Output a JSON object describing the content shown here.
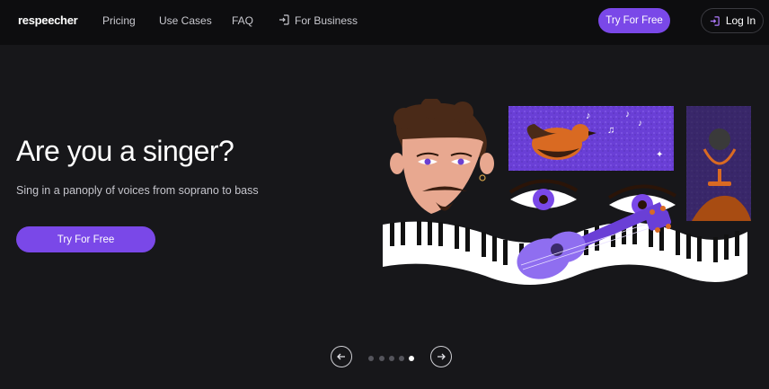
{
  "nav": {
    "logo": "respeecher",
    "links": [
      "Pricing",
      "Use Cases",
      "FAQ",
      "For Business"
    ],
    "cta_label": "Try For Free",
    "login_label": "Log In"
  },
  "hero": {
    "title": "Are you a singer?",
    "subtitle": "Sing in a panoply of voices from soprano to bass",
    "cta_label": "Try For Free"
  },
  "carousel": {
    "slide_count": 5,
    "active_index": 4
  },
  "colors": {
    "accent": "#7a48e8",
    "background": "#17171a",
    "nav_background": "#0d0d0f"
  }
}
